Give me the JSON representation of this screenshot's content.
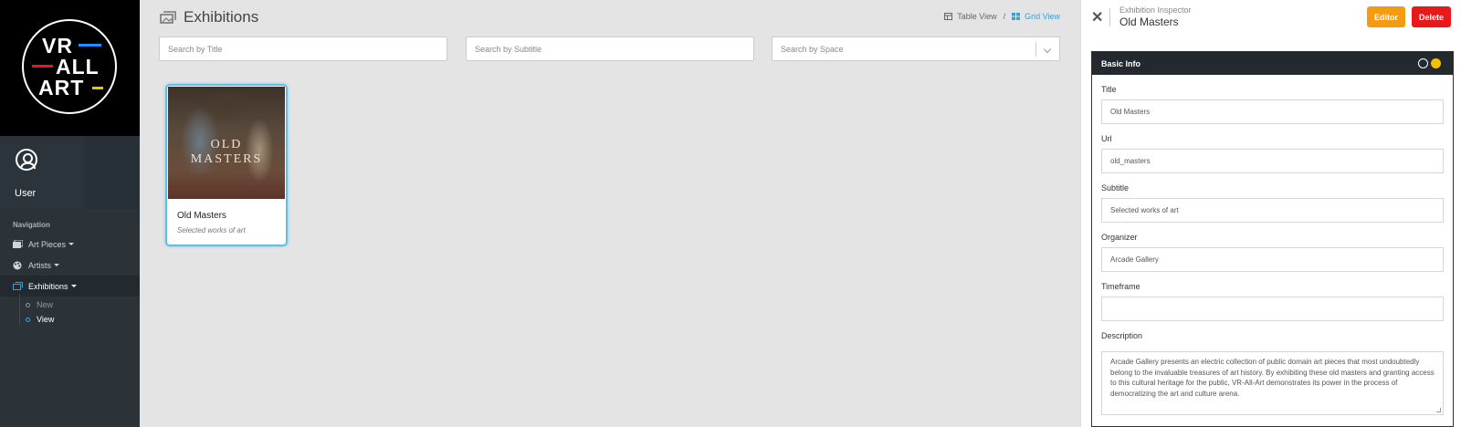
{
  "logo": {
    "lines": [
      "VR",
      "ALL",
      "ART"
    ],
    "colors": {
      "blue": "#1e90ff",
      "red": "#e8191b",
      "yellow": "#f2c200"
    }
  },
  "user": {
    "name": "User"
  },
  "nav": {
    "header": "Navigation",
    "items": [
      {
        "label": "Art Pieces",
        "icon": "images-icon"
      },
      {
        "label": "Artists",
        "icon": "palette-icon"
      },
      {
        "label": "Exhibitions",
        "icon": "gallery-icon",
        "active": true
      }
    ],
    "subitems": [
      {
        "label": "New"
      },
      {
        "label": "View",
        "current": true
      }
    ]
  },
  "main": {
    "title": "Exhibitions",
    "view_toggle": {
      "table": "Table View",
      "separator": "/",
      "grid": "Grid View",
      "active": "grid"
    },
    "search": {
      "title_placeholder": "Search by Title",
      "subtitle_placeholder": "Search by Subtitle",
      "space_placeholder": "Search by Space"
    },
    "cards": [
      {
        "image_text": [
          "OLD",
          "MASTERS"
        ],
        "title": "Old Masters",
        "subtitle": "Selected works of art"
      }
    ]
  },
  "inspector": {
    "label": "Exhibition Inspector",
    "title": "Old Masters",
    "editor_label": "Editor",
    "delete_label": "Delete",
    "panel_title": "Basic Info",
    "fields": {
      "title": {
        "label": "Title",
        "value": "Old Masters"
      },
      "url": {
        "label": "Url",
        "value": "old_masters"
      },
      "subtitle": {
        "label": "Subtitle",
        "value": "Selected works of art"
      },
      "organizer": {
        "label": "Organizer",
        "value": "Arcade Gallery"
      },
      "timeframe": {
        "label": "Timeframe",
        "value": ""
      },
      "description": {
        "label": "Description",
        "value": "Arcade Gallery presents an electric collection of public domain art pieces that most undoubtedly belong to the invaluable treasures of art history. By exhibiting these old masters and granting access to this cultural heritage for the public, VR-All-Art demonstrates its power in the process of democratizing the art and culture arena."
      }
    },
    "accent_colors": {
      "editor": "#f39c12",
      "delete": "#e8191b",
      "selection": "#3c9fd4"
    }
  }
}
